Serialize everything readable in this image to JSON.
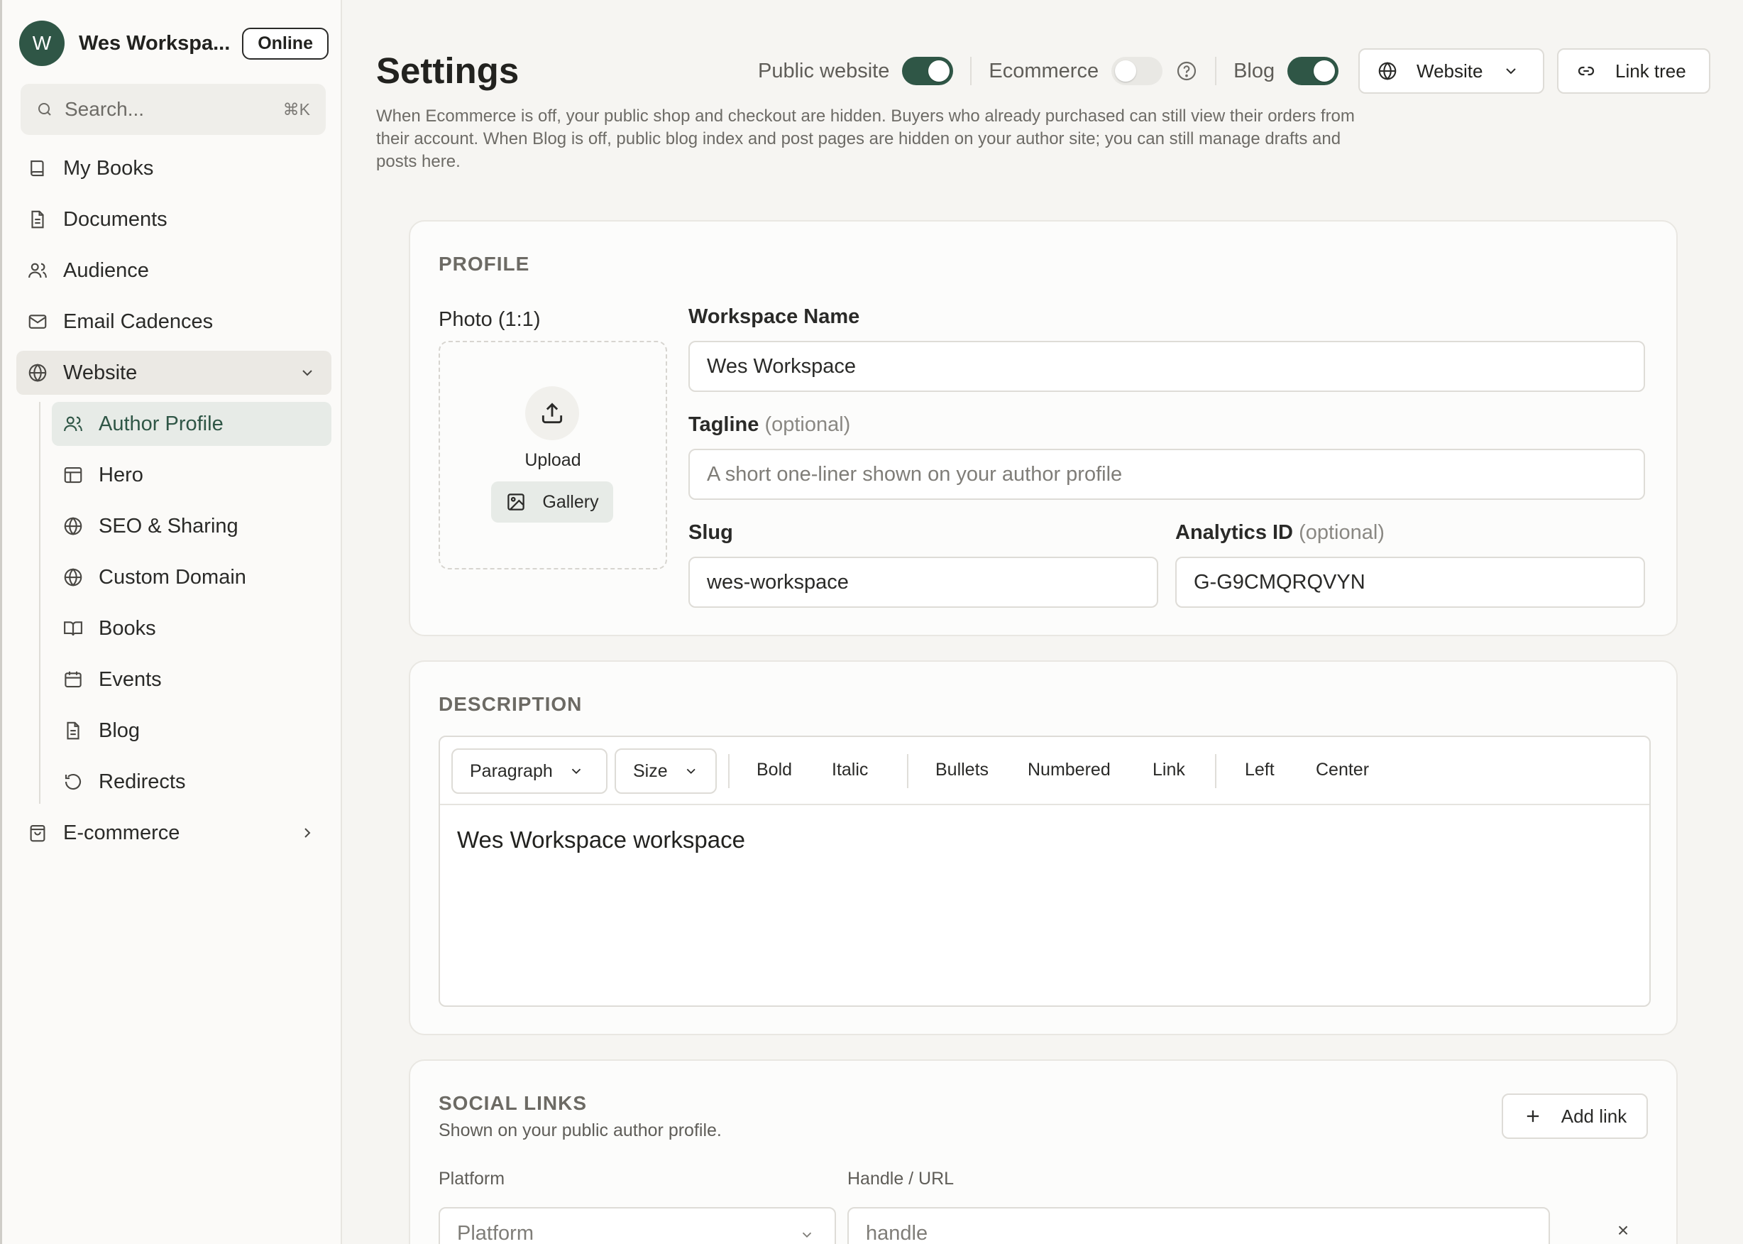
{
  "workspace": {
    "initial": "W",
    "name": "Wes Workspa...",
    "status": "Online"
  },
  "search": {
    "placeholder": "Search...",
    "shortcut": "⌘K"
  },
  "sidebar": {
    "items": [
      {
        "label": "My Books",
        "icon": "book-icon"
      },
      {
        "label": "Documents",
        "icon": "document-icon"
      },
      {
        "label": "Audience",
        "icon": "users-icon"
      },
      {
        "label": "Email Cadences",
        "icon": "mail-icon"
      },
      {
        "label": "Website",
        "icon": "globe-icon"
      },
      {
        "label": "E-commerce",
        "icon": "shopping-bag-icon"
      }
    ],
    "website_sub": [
      {
        "label": "Author Profile",
        "icon": "users-icon"
      },
      {
        "label": "Hero",
        "icon": "layout-icon"
      },
      {
        "label": "SEO & Sharing",
        "icon": "globe-icon"
      },
      {
        "label": "Custom Domain",
        "icon": "globe-icon"
      },
      {
        "label": "Books",
        "icon": "open-book-icon"
      },
      {
        "label": "Events",
        "icon": "calendar-icon"
      },
      {
        "label": "Blog",
        "icon": "document-icon"
      },
      {
        "label": "Redirects",
        "icon": "history-icon"
      }
    ]
  },
  "header": {
    "title": "Settings",
    "toggles": [
      {
        "label": "Public website",
        "on": true
      },
      {
        "label": "Ecommerce",
        "on": false
      },
      {
        "label": "Blog",
        "on": true
      }
    ],
    "website_btn": "Website",
    "link_tree_btn": "Link tree",
    "hint": "When Ecommerce is off, your public shop and checkout are hidden. Buyers who already purchased can still view their orders from their account. When Blog is off, public blog index and post pages are hidden on your author site; you can still manage drafts and posts here."
  },
  "profile": {
    "heading": "PROFILE",
    "photo_label": "Photo (1:1)",
    "upload_label": "Upload",
    "gallery_label": "Gallery",
    "workspace_name_label": "Workspace Name",
    "workspace_name_value": "Wes Workspace",
    "tagline_label": "Tagline",
    "tagline_optional": "(optional)",
    "tagline_placeholder": "A short one-liner shown on your author profile",
    "slug_label": "Slug",
    "slug_value": "wes-workspace",
    "analytics_label": "Analytics ID",
    "analytics_optional": "(optional)",
    "analytics_value": "G-G9CMQRQVYN"
  },
  "description": {
    "heading": "DESCRIPTION",
    "paragraph_select": "Paragraph",
    "size_select": "Size",
    "toolbar": [
      "Bold",
      "Italic",
      "Bullets",
      "Numbered",
      "Link",
      "Left",
      "Center"
    ],
    "content": "Wes Workspace workspace"
  },
  "social": {
    "heading": "SOCIAL LINKS",
    "subtitle": "Shown on your public author profile.",
    "add_link": "Add link",
    "platform_label": "Platform",
    "handle_label": "Handle / URL",
    "platform_placeholder": "Platform",
    "handle_placeholder": "handle",
    "remove": "×"
  },
  "colors": {
    "accent": "#2f5646",
    "active_bg": "#e7ebe7"
  }
}
